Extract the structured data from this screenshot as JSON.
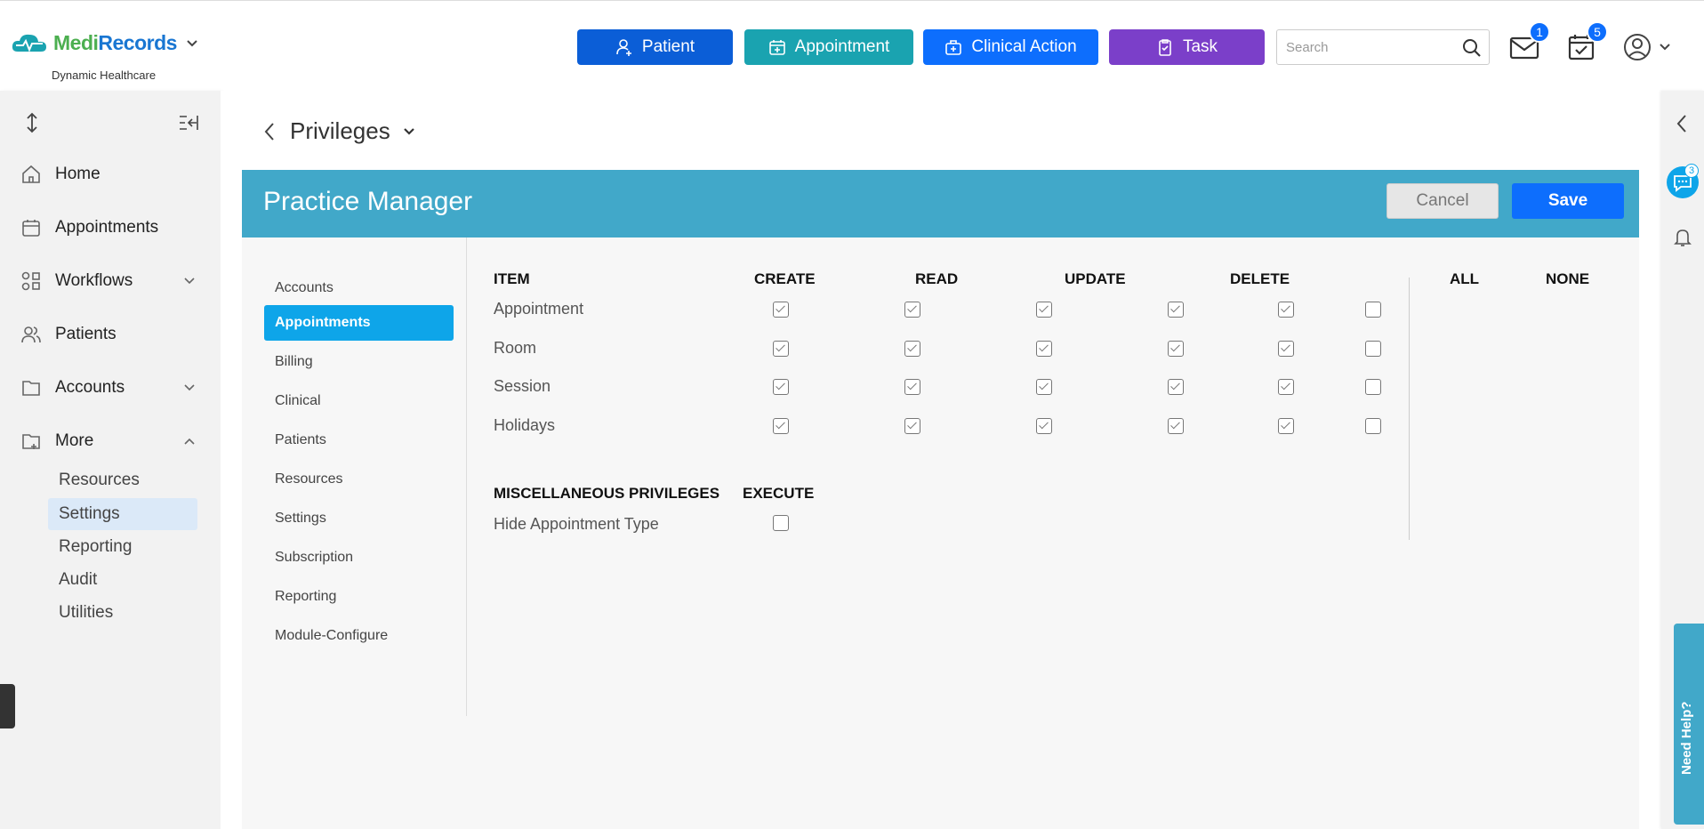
{
  "brand": {
    "name_part1": "Medi",
    "name_part2": "Records",
    "subtitle": "Dynamic Healthcare"
  },
  "quick_actions": {
    "patient": "Patient",
    "appointment": "Appointment",
    "clinical_action": "Clinical Action",
    "task": "Task"
  },
  "search": {
    "placeholder": "Search"
  },
  "badges": {
    "mail": "1",
    "calendar": "5"
  },
  "sidebar": {
    "items": [
      {
        "label": "Home"
      },
      {
        "label": "Appointments"
      },
      {
        "label": "Workflows"
      },
      {
        "label": "Patients"
      },
      {
        "label": "Accounts"
      },
      {
        "label": "More"
      }
    ],
    "sub_items": [
      {
        "label": "Resources"
      },
      {
        "label": "Settings"
      },
      {
        "label": "Reporting"
      },
      {
        "label": "Audit"
      },
      {
        "label": "Utilities"
      }
    ]
  },
  "breadcrumb": {
    "title": "Privileges"
  },
  "panel": {
    "title": "Practice Manager",
    "cancel": "Cancel",
    "save": "Save"
  },
  "submenu": [
    "Accounts",
    "Appointments",
    "Billing",
    "Clinical",
    "Patients",
    "Resources",
    "Settings",
    "Subscription",
    "Reporting",
    "Module-Configure"
  ],
  "table": {
    "headers": {
      "item": "ITEM",
      "create": "CREATE",
      "read": "READ",
      "update": "UPDATE",
      "delete": "DELETE",
      "all": "ALL",
      "none": "NONE"
    },
    "rows": [
      {
        "label": "Appointment",
        "create": true,
        "read": true,
        "update": true,
        "delete": true,
        "all": true,
        "none": false
      },
      {
        "label": "Room",
        "create": true,
        "read": true,
        "update": true,
        "delete": true,
        "all": true,
        "none": false
      },
      {
        "label": "Session",
        "create": true,
        "read": true,
        "update": true,
        "delete": true,
        "all": true,
        "none": false
      },
      {
        "label": "Holidays",
        "create": true,
        "read": true,
        "update": true,
        "delete": true,
        "all": true,
        "none": false
      }
    ],
    "misc_header": "MISCELLANEOUS PRIVILEGES",
    "execute_header": "EXECUTE",
    "misc_rows": [
      {
        "label": "Hide Appointment Type",
        "execute": false
      }
    ]
  },
  "right_rail": {
    "chat_count": "3",
    "help_label": "Need Help?"
  },
  "colors": {
    "header_bar": "#41a8c9",
    "primary": "#0d6efd",
    "active_submenu": "#0ea5e9"
  }
}
